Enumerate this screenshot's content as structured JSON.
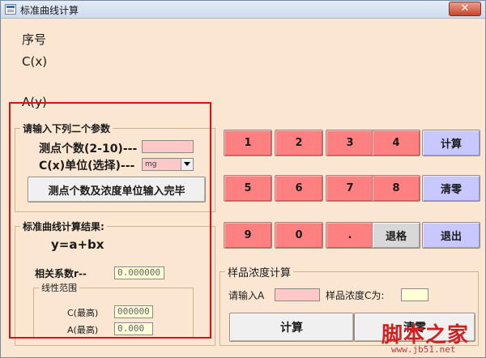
{
  "window": {
    "title": "标准曲线计算",
    "close_label": "✕"
  },
  "top_labels": {
    "index": "序号",
    "cx": "C(x)",
    "ay": "A(y)"
  },
  "params_group": {
    "title": "请输入下列二个参数",
    "points_label": "测点个数(2-10)---",
    "points_value": "",
    "unit_label": "C(x)单位(选择)---",
    "unit_value": "mg",
    "confirm_button": "测点个数及浓度单位输入完毕"
  },
  "result_group": {
    "title": "标准曲线计算结果:",
    "formula": "y=a+bx",
    "corr_label": "相关系数r--",
    "corr_value": "0.000000",
    "linear_range_title": "线性范围",
    "c_max_label": "C(最高)",
    "c_max_value": "000000",
    "a_max_label": "A(最高)",
    "a_max_value": "0.000"
  },
  "keypad": {
    "row1": [
      "1",
      "2",
      "3",
      "4"
    ],
    "row2": [
      "5",
      "6",
      "7",
      "8"
    ],
    "row3": [
      "9",
      "0",
      "."
    ],
    "backspace": "退格",
    "calc": "计算",
    "clear": "清零",
    "exit": "退出"
  },
  "sample_group": {
    "title": "样品浓度计算",
    "input_a_label": "请输入A",
    "input_a_value": "",
    "conc_label": "样品浓度C为:",
    "conc_value": "",
    "calc_button": "计算",
    "clear_button": "清零"
  },
  "watermark": {
    "text": "脚本之家",
    "url": "www.jb51.net"
  },
  "colors": {
    "background": "#fbe6d2",
    "key_red": "#ff8080",
    "key_blue": "#c8c8ff",
    "highlight_frame": "#e01010"
  }
}
